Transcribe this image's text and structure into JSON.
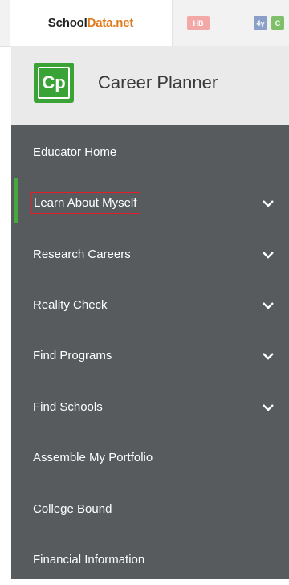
{
  "topbar": {
    "brand_school": "School",
    "brand_data": "Data.net",
    "apps": [
      "HB",
      "4y",
      "C"
    ]
  },
  "header": {
    "logo_text": "Cp",
    "title": "Career Planner"
  },
  "sidebar": {
    "items": [
      {
        "label": "Educator Home",
        "has_chevron": false
      },
      {
        "label": "Learn About Myself",
        "has_chevron": true,
        "active": true
      },
      {
        "label": "Research Careers",
        "has_chevron": true
      },
      {
        "label": "Reality Check",
        "has_chevron": true
      },
      {
        "label": "Find Programs",
        "has_chevron": true
      },
      {
        "label": "Find Schools",
        "has_chevron": true
      },
      {
        "label": "Assemble My Portfolio",
        "has_chevron": false
      },
      {
        "label": "College Bound",
        "has_chevron": false
      },
      {
        "label": "Financial Information",
        "has_chevron": false
      }
    ]
  },
  "colors": {
    "sidebar_bg": "#575b5e",
    "accent_green": "#46a83d",
    "brand_orange": "#e07a1c",
    "highlight_red": "#e0202a"
  }
}
